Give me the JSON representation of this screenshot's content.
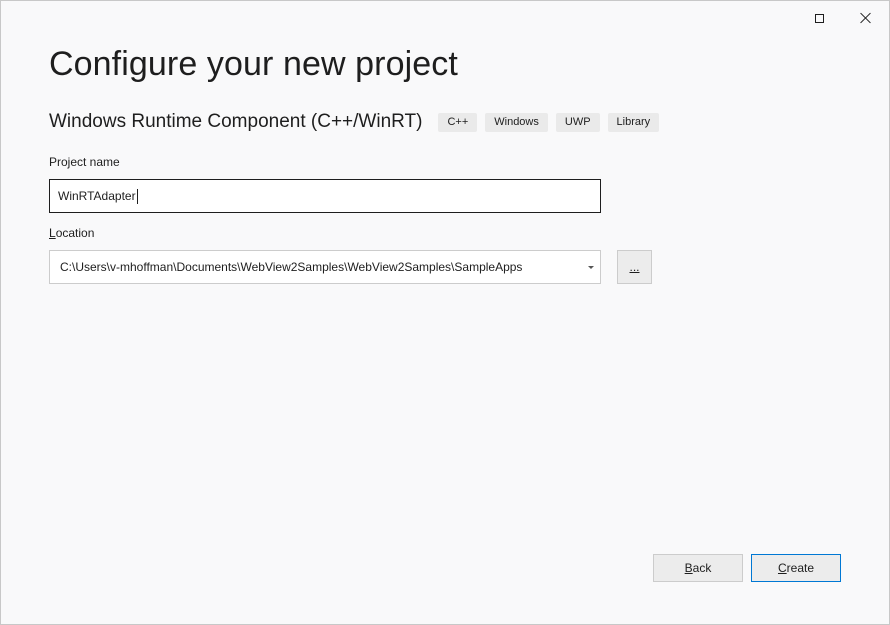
{
  "window": {
    "maximize_icon": "maximize-icon",
    "close_icon": "close-icon"
  },
  "header": {
    "title": "Configure your new project"
  },
  "template": {
    "name": "Windows Runtime Component (C++/WinRT)",
    "tags": [
      "C++",
      "Windows",
      "UWP",
      "Library"
    ]
  },
  "project_name": {
    "label": "Project name",
    "value": "WinRTAdapter"
  },
  "location": {
    "label_first": "L",
    "label_rest": "ocation",
    "value": "C:\\Users\\v-mhoffman\\Documents\\WebView2Samples\\WebView2Samples\\SampleApps",
    "browse_label": "..."
  },
  "footer": {
    "back_mnemonic": "B",
    "back_rest": "ack",
    "create_mnemonic": "C",
    "create_rest": "reate"
  },
  "colors": {
    "accent": "#0078d4",
    "background": "#f9f9fa"
  }
}
